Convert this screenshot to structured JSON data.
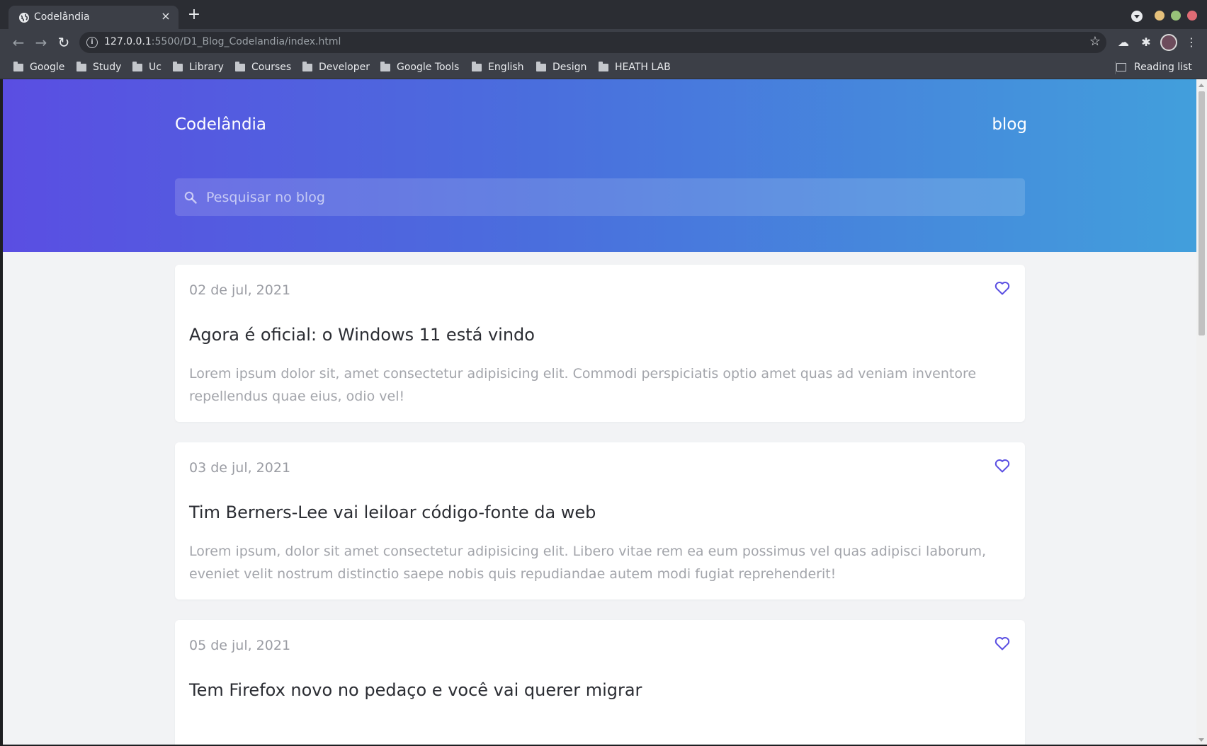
{
  "browser": {
    "tab_title": "Codelândia",
    "tab_close": "×",
    "new_tab": "+",
    "url_host": "127.0.0.1",
    "url_path": ":5500/D1_Blog_Codelandia/index.html",
    "bookmarks": [
      {
        "label": "Google",
        "icon": "folder-icon"
      },
      {
        "label": "Study",
        "icon": "folder-icon"
      },
      {
        "label": "Uc",
        "icon": "folder-icon"
      },
      {
        "label": "Library",
        "icon": "folder-icon"
      },
      {
        "label": "Courses",
        "icon": "folder-icon"
      },
      {
        "label": "Developer",
        "icon": "folder-icon"
      },
      {
        "label": "Google Tools",
        "icon": "folder-icon"
      },
      {
        "label": "English",
        "icon": "folder-icon"
      },
      {
        "label": "Design",
        "icon": "folder-icon"
      },
      {
        "label": "HEATH LAB",
        "icon": "folder-icon"
      }
    ],
    "reading_list": "Reading list",
    "traffic_colors": {
      "minimize": "#e5c07b",
      "maximize": "#98c379",
      "close": "#e06c75"
    }
  },
  "page": {
    "brand": "Codelândia",
    "nav_blog": "blog",
    "search_placeholder": "Pesquisar no blog",
    "accent_color": "#5a4ee2",
    "gradient": [
      "#5a4ee2",
      "#429fdc"
    ],
    "posts": [
      {
        "date": "02 de jul, 2021",
        "title": "Agora é oficial: o Windows 11 está vindo",
        "body": "Lorem ipsum dolor sit, amet consectetur adipisicing elit. Commodi perspiciatis optio amet quas ad veniam inventore repellendus quae eius, odio vel!",
        "liked": false
      },
      {
        "date": "03 de jul, 2021",
        "title": "Tim Berners-Lee vai leiloar código-fonte da web",
        "body": "Lorem ipsum, dolor sit amet consectetur adipisicing elit. Libero vitae rem ea eum possimus vel quas adipisci laborum, eveniet velit nostrum distinctio saepe nobis quis repudiandae autem modi fugiat reprehenderit!",
        "liked": false
      },
      {
        "date": "05 de jul, 2021",
        "title": "Tem Firefox novo no pedaço e você vai querer migrar",
        "body": "",
        "liked": false
      }
    ]
  }
}
